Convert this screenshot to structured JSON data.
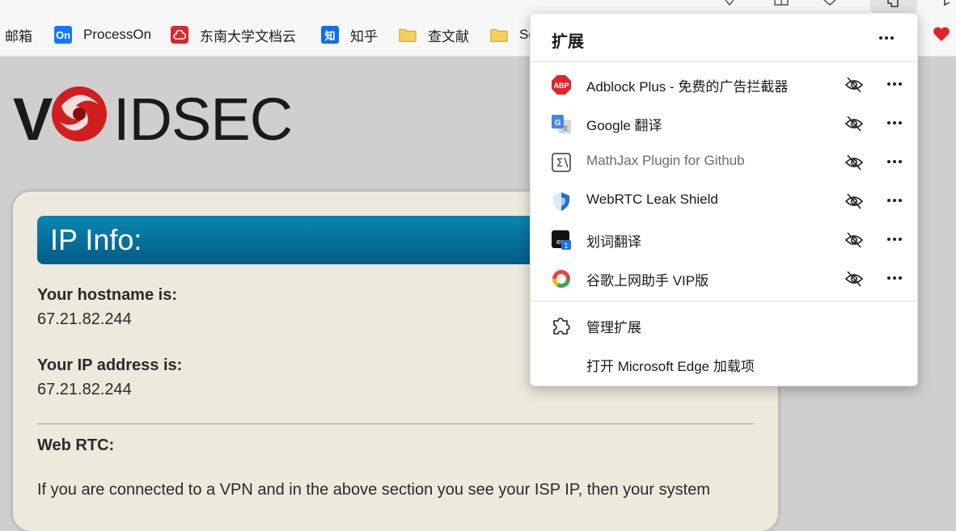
{
  "bookmarks": [
    {
      "label": "邮箱",
      "icon": "none"
    },
    {
      "label": "ProcessOn",
      "icon": "processon-icon",
      "icon_text": "On"
    },
    {
      "label": "东南大学文档云",
      "icon": "cloud-icon"
    },
    {
      "label": "知乎",
      "icon": "zhihu-icon",
      "icon_text": "知"
    },
    {
      "label": "查文献",
      "icon": "folder-icon"
    },
    {
      "label": "Se",
      "icon": "folder-icon"
    }
  ],
  "page": {
    "banner": "IP Info:",
    "hostname_label": "Your hostname is:",
    "hostname_value": "67.21.82.244",
    "ip_label": "Your IP address is:",
    "ip_value": "67.21.82.244",
    "webrtc_label": "Web RTC:",
    "paragraph": "If you are connected to a VPN and in the above section you see your ISP IP, then your system"
  },
  "extensions_popup": {
    "title": "扩展",
    "items": [
      {
        "name": "Adblock Plus - 免费的广告拦截器",
        "icon": "adblock-icon",
        "dim": false
      },
      {
        "name": "Google 翻译",
        "icon": "google-translate-icon",
        "dim": false
      },
      {
        "name": "MathJax Plugin for Github",
        "icon": "mathjax-icon",
        "dim": true
      },
      {
        "name": "WebRTC Leak Shield",
        "icon": "shield-icon",
        "dim": false
      },
      {
        "name": "划词翻译",
        "icon": "translate-icon",
        "dim": false
      },
      {
        "name": "谷歌上网助手 VIP版",
        "icon": "chrome-helper-icon",
        "dim": false
      }
    ],
    "manage_label": "管理扩展",
    "open_addons_label": "打开 Microsoft Edge 加载项"
  },
  "colors": {
    "banner_top": "#0a86b2",
    "banner_bottom": "#045c85",
    "card_bg": "#ece9dd",
    "page_bg": "#cfcfcf",
    "logo_red": "#d11f1f"
  }
}
